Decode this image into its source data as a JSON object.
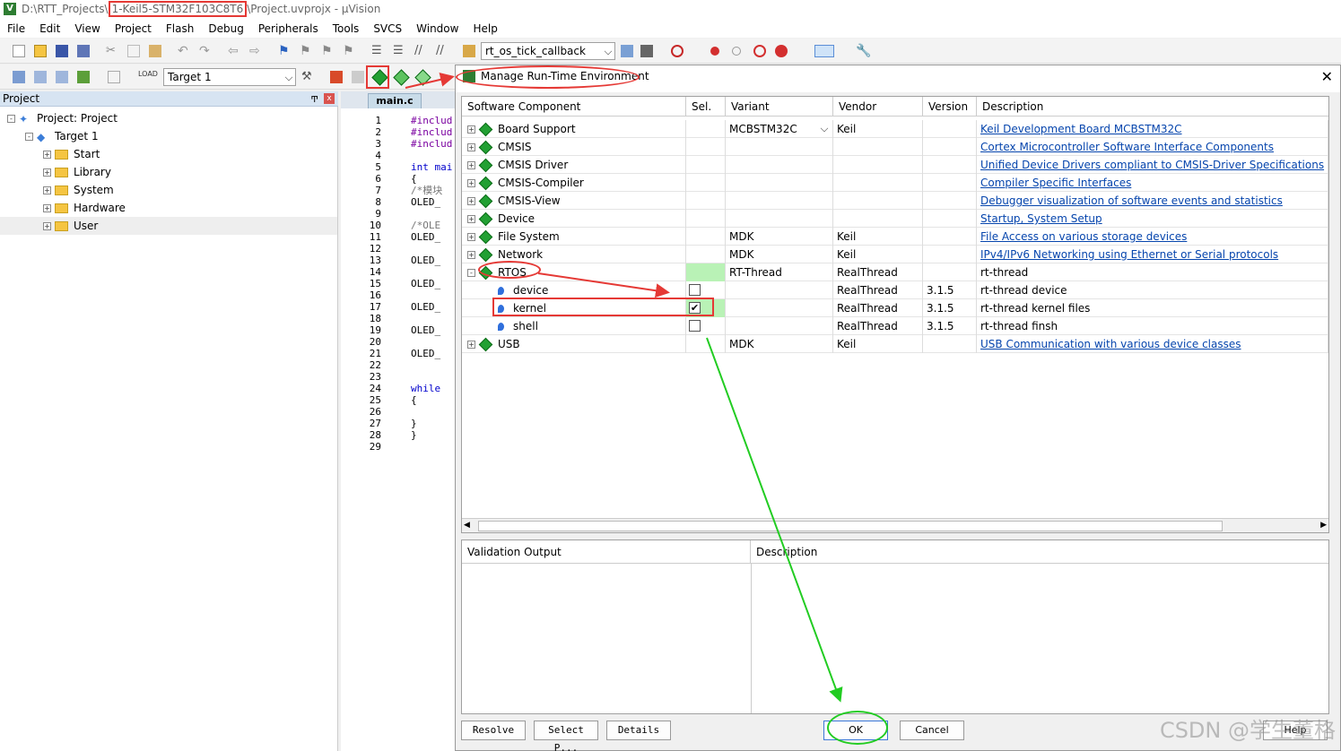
{
  "window": {
    "title_prefix": "D:\\RTT_Projects\\",
    "title_highlight": "1-Keil5-STM32F103C8T6",
    "title_suffix": "\\Project.uvprojx - µVision",
    "app_icon": "V"
  },
  "menu": [
    "File",
    "Edit",
    "View",
    "Project",
    "Flash",
    "Debug",
    "Peripherals",
    "Tools",
    "SVCS",
    "Window",
    "Help"
  ],
  "toolbar": {
    "function_combo": "rt_os_tick_callback",
    "target_combo": "Target 1"
  },
  "project_panel": {
    "header": "Project",
    "close": "x",
    "pin": "Ͳ",
    "tree": [
      {
        "label": "Project: Project",
        "level": 0,
        "kind": "project",
        "expander": "-"
      },
      {
        "label": "Target 1",
        "level": 1,
        "kind": "target",
        "expander": "-"
      },
      {
        "label": "Start",
        "level": 2,
        "kind": "folder",
        "expander": "+"
      },
      {
        "label": "Library",
        "level": 2,
        "kind": "folder",
        "expander": "+"
      },
      {
        "label": "System",
        "level": 2,
        "kind": "folder",
        "expander": "+"
      },
      {
        "label": "Hardware",
        "level": 2,
        "kind": "folder",
        "expander": "+"
      },
      {
        "label": "User",
        "level": 2,
        "kind": "folder",
        "expander": "+"
      }
    ]
  },
  "editor": {
    "tab": "main.c",
    "line_numbers": [
      "1",
      "2",
      "3",
      "4",
      "5",
      "6",
      "7",
      "8",
      "9",
      "10",
      "11",
      "12",
      "13",
      "14",
      "15",
      "16",
      "17",
      "18",
      "19",
      "20",
      "21",
      "22",
      "23",
      "24",
      "25",
      "26",
      "27",
      "28",
      "29"
    ],
    "code_lines": [
      {
        "line": 1,
        "text": "#includ",
        "cls": "pre"
      },
      {
        "line": 2,
        "text": "#includ",
        "cls": "pre"
      },
      {
        "line": 3,
        "text": "#includ",
        "cls": "pre"
      },
      {
        "line": 5,
        "text": "int mai",
        "cls": "kw"
      },
      {
        "line": 6,
        "text": "{",
        "cls": ""
      },
      {
        "line": 7,
        "text": "  /*模块",
        "cls": "cm"
      },
      {
        "line": 8,
        "text": "  OLED_",
        "cls": ""
      },
      {
        "line": 10,
        "text": "  /*OLE",
        "cls": "cm"
      },
      {
        "line": 11,
        "text": "  OLED_",
        "cls": ""
      },
      {
        "line": 13,
        "text": "  OLED_",
        "cls": ""
      },
      {
        "line": 15,
        "text": "  OLED_",
        "cls": ""
      },
      {
        "line": 17,
        "text": "  OLED_",
        "cls": ""
      },
      {
        "line": 19,
        "text": "  OLED_",
        "cls": ""
      },
      {
        "line": 21,
        "text": "  OLED_",
        "cls": ""
      },
      {
        "line": 24,
        "text": "  while",
        "cls": "kw"
      },
      {
        "line": 25,
        "text": "  {",
        "cls": ""
      },
      {
        "line": 27,
        "text": "  }",
        "cls": ""
      },
      {
        "line": 28,
        "text": "}",
        "cls": ""
      }
    ]
  },
  "dialog": {
    "title": "Manage Run-Time Environment",
    "close": "✕",
    "columns": [
      "Software Component",
      "Sel.",
      "Variant",
      "Vendor",
      "Version",
      "Description"
    ],
    "rows": [
      {
        "name": "Board Support",
        "level": 0,
        "expander": "+",
        "icon": "gem",
        "sel": "",
        "variant": "MCBSTM32C",
        "variant_combo": true,
        "vendor": "Keil",
        "version": "",
        "desc": "Keil Development Board MCBSTM32C",
        "link": true
      },
      {
        "name": "CMSIS",
        "level": 0,
        "expander": "+",
        "icon": "gem",
        "sel": "",
        "variant": "",
        "vendor": "",
        "version": "",
        "desc": "Cortex Microcontroller Software Interface Components",
        "link": true
      },
      {
        "name": "CMSIS Driver",
        "level": 0,
        "expander": "+",
        "icon": "gem",
        "sel": "",
        "variant": "",
        "vendor": "",
        "version": "",
        "desc": "Unified Device Drivers compliant to CMSIS-Driver Specifications",
        "link": true
      },
      {
        "name": "CMSIS-Compiler",
        "level": 0,
        "expander": "+",
        "icon": "gem",
        "sel": "",
        "variant": "",
        "vendor": "",
        "version": "",
        "desc": "Compiler Specific Interfaces",
        "link": true
      },
      {
        "name": "CMSIS-View",
        "level": 0,
        "expander": "+",
        "icon": "gem",
        "sel": "",
        "variant": "",
        "vendor": "",
        "version": "",
        "desc": "Debugger visualization of software events and statistics",
        "link": true
      },
      {
        "name": "Device",
        "level": 0,
        "expander": "+",
        "icon": "gem",
        "sel": "",
        "variant": "",
        "vendor": "",
        "version": "",
        "desc": "Startup, System Setup",
        "link": true
      },
      {
        "name": "File System",
        "level": 0,
        "expander": "+",
        "icon": "gem",
        "sel": "",
        "variant": "MDK",
        "vendor": "Keil",
        "version": "",
        "desc": "File Access on various storage devices",
        "link": true
      },
      {
        "name": "Network",
        "level": 0,
        "expander": "+",
        "icon": "gem",
        "sel": "",
        "variant": "MDK",
        "vendor": "Keil",
        "version": "",
        "desc": "IPv4/IPv6 Networking using Ethernet or Serial protocols",
        "link": true
      },
      {
        "name": "RTOS",
        "level": 0,
        "expander": "-",
        "icon": "gem",
        "sel": "green",
        "variant": "RT-Thread",
        "vendor": "RealThread",
        "version": "",
        "desc": "rt-thread",
        "link": false
      },
      {
        "name": "device",
        "level": 1,
        "expander": "",
        "icon": "bullet",
        "sel": "unchecked",
        "variant": "",
        "vendor": "RealThread",
        "version": "3.1.5",
        "desc": "rt-thread device",
        "link": false
      },
      {
        "name": "kernel",
        "level": 1,
        "expander": "",
        "icon": "bullet",
        "sel": "checked",
        "variant": "",
        "vendor": "RealThread",
        "version": "3.1.5",
        "desc": "rt-thread kernel files",
        "link": false
      },
      {
        "name": "shell",
        "level": 1,
        "expander": "",
        "icon": "bullet",
        "sel": "unchecked",
        "variant": "",
        "vendor": "RealThread",
        "version": "3.1.5",
        "desc": "rt-thread finsh",
        "link": false
      },
      {
        "name": "USB",
        "level": 0,
        "expander": "+",
        "icon": "gem",
        "sel": "",
        "variant": "MDK",
        "vendor": "Keil",
        "version": "",
        "desc": "USB Communication with various device classes",
        "link": true
      }
    ],
    "validation": {
      "col1": "Validation Output",
      "col2": "Description"
    },
    "buttons": {
      "resolve": "Resolve",
      "select": "Select P...",
      "details": "Details",
      "ok": "OK",
      "cancel": "Cancel",
      "help": "Help"
    },
    "checkmark": "✔"
  },
  "watermark": "CSDN @学生董格",
  "colors": {
    "annotation_red": "#e53935",
    "annotation_green": "#22cc22",
    "link": "#0645ad",
    "selection_green": "#b9f2b6"
  }
}
